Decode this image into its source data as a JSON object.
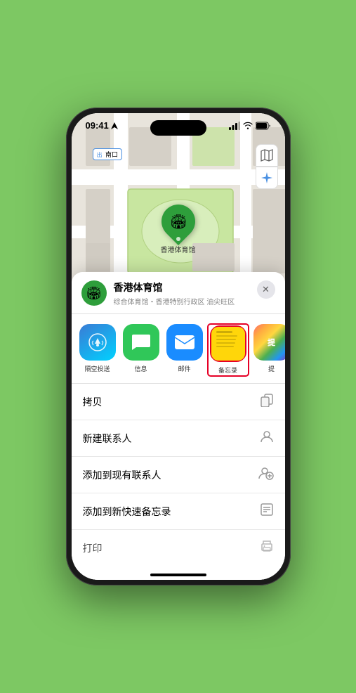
{
  "status_bar": {
    "time": "09:41",
    "location_arrow": true
  },
  "map": {
    "label": "南口",
    "marker_label": "香港体育馆",
    "marker_icon": "🏟"
  },
  "map_controls": {
    "map_icon": "🗺",
    "location_icon": "↗"
  },
  "location_card": {
    "icon": "🏟",
    "name": "香港体育馆",
    "subtitle": "综合体育馆・香港特别行政区 油尖旺区",
    "close_label": "✕"
  },
  "share_items": [
    {
      "id": "airdrop",
      "label": "隔空投送",
      "type": "airdrop"
    },
    {
      "id": "messages",
      "label": "信息",
      "type": "messages"
    },
    {
      "id": "mail",
      "label": "邮件",
      "type": "mail"
    },
    {
      "id": "notes",
      "label": "备忘录",
      "type": "notes"
    },
    {
      "id": "more",
      "label": "提",
      "type": "more"
    }
  ],
  "actions": [
    {
      "id": "copy",
      "label": "拷贝",
      "icon": "⎘"
    },
    {
      "id": "new-contact",
      "label": "新建联系人",
      "icon": "👤"
    },
    {
      "id": "add-to-contact",
      "label": "添加到现有联系人",
      "icon": "👤+"
    },
    {
      "id": "add-to-notes",
      "label": "添加到新快速备忘录",
      "icon": "📋"
    },
    {
      "id": "print",
      "label": "打印",
      "icon": "🖨"
    }
  ]
}
